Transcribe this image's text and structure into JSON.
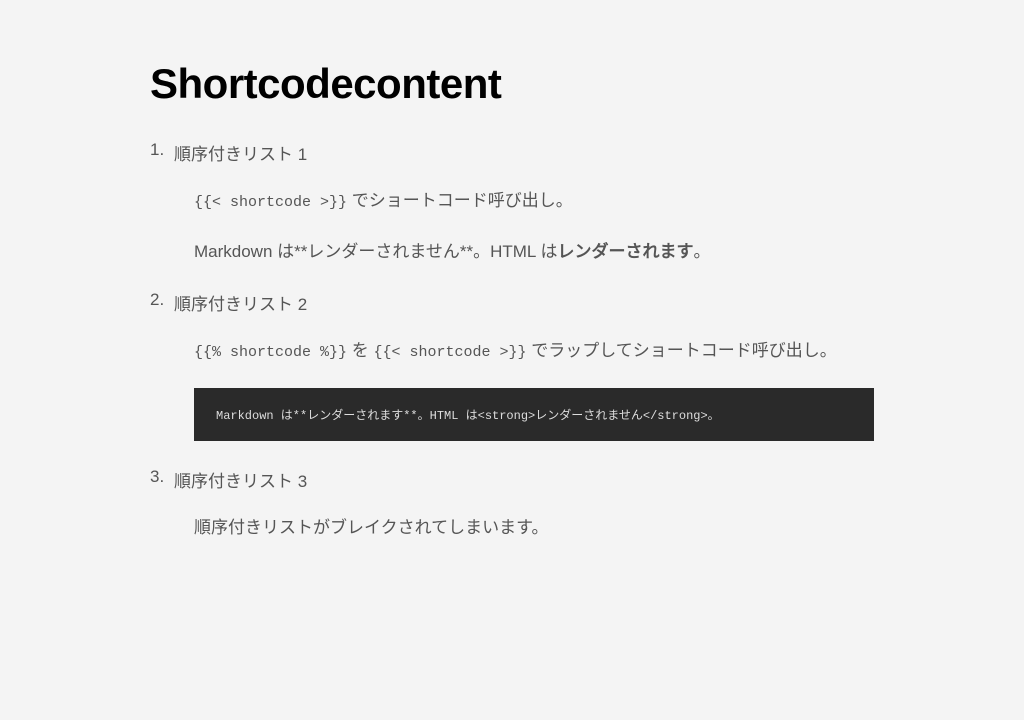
{
  "title": "Shortcodecontent",
  "list": [
    {
      "label": "順序付きリスト 1",
      "line1_code": "{{< shortcode >}}",
      "line1_rest": " でショートコード呼び出し。",
      "line2_pre": "Markdown は**レンダーされません**。HTML は",
      "line2_bold": "レンダーされます",
      "line2_post": "。"
    },
    {
      "label": "順序付きリスト 2",
      "line1_code1": "{{% shortcode %}}",
      "line1_mid": " を ",
      "line1_code2": "{{< shortcode >}}",
      "line1_rest": " でラップしてショートコード呼び出し。",
      "codeblock": "Markdown は**レンダーされます**。HTML は<strong>レンダーされません</strong>。"
    },
    {
      "label": "順序付きリスト 3",
      "line1": "順序付きリストがブレイクされてしまいます。"
    }
  ]
}
